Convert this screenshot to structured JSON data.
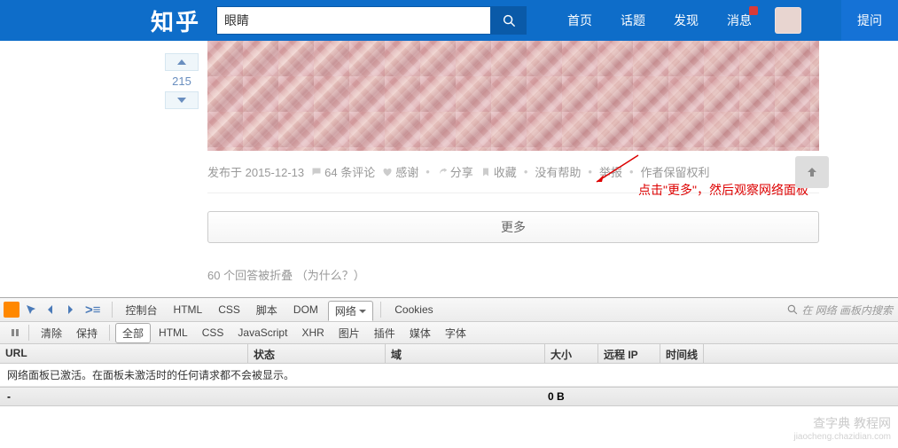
{
  "header": {
    "logo": "知乎",
    "search_value": "眼睛",
    "nav": [
      "首页",
      "话题",
      "发现",
      "消息"
    ],
    "ask": "提问"
  },
  "vote": {
    "count": "215"
  },
  "meta": {
    "posted": "发布于 2015-12-13",
    "comments": "64 条评论",
    "thanks": "感谢",
    "share": "分享",
    "favorite": "收藏",
    "nohelp": "没有帮助",
    "report": "举报",
    "rights": "作者保留权利"
  },
  "more_btn": "更多",
  "collapsed": {
    "text": "60 个回答被折叠 ",
    "why": "（为什么？）"
  },
  "annotation": "点击\"更多\"，然后观察网络面板",
  "devtools": {
    "tabs_row1": {
      "console": "控制台",
      "html": "HTML",
      "css": "CSS",
      "script": "脚本",
      "dom": "DOM",
      "network": "网络",
      "cookies": "Cookies"
    },
    "tabs_row2": {
      "clear": "清除",
      "persist": "保持",
      "all": "全部",
      "html": "HTML",
      "css": "CSS",
      "js": "JavaScript",
      "xhr": "XHR",
      "img": "图片",
      "plugin": "插件",
      "media": "媒体",
      "font": "字体"
    },
    "search_placeholder": "在 网络 画板内搜索",
    "headers": {
      "url": "URL",
      "status": "状态",
      "domain": "域",
      "size": "大小",
      "remote": "远程 IP",
      "timeline": "时间线"
    },
    "message": "网络面板已激活。在面板未激活时的任何请求都不会被显示。",
    "total_dash": "-",
    "total_size": "0 B"
  },
  "watermark": {
    "main": "查字典 教程网",
    "sub": "jiaocheng.chazidian.com"
  }
}
